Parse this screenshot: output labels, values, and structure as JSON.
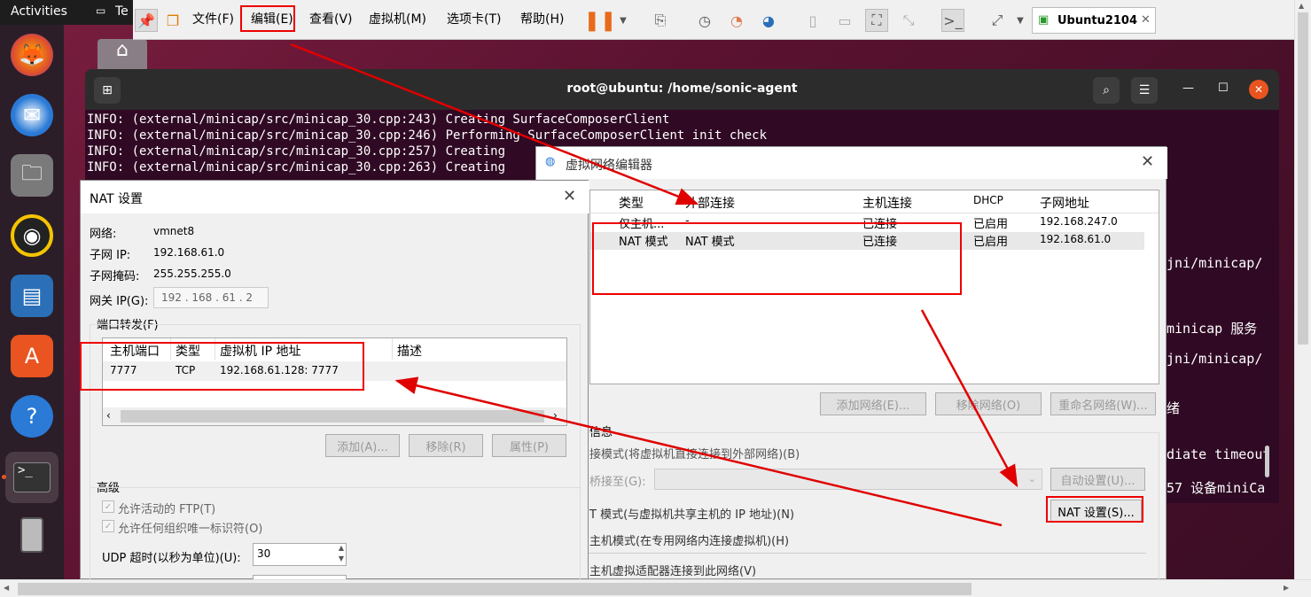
{
  "topbar": {
    "activities": "Activities",
    "app_short": "Te"
  },
  "vmware": {
    "menus": [
      "文件(F)",
      "编辑(E)",
      "查看(V)",
      "虚拟机(M)",
      "选项卡(T)",
      "帮助(H)"
    ],
    "tab_label": "Ubuntu2104"
  },
  "terminal": {
    "title": "root@ubuntu: /home/sonic-agent",
    "lines": [
      "INFO: (external/minicap/src/minicap_30.cpp:243) Creating SurfaceComposerClient",
      "INFO: (external/minicap/src/minicap_30.cpp:246) Performing SurfaceComposerClient init check",
      "INFO: (external/minicap/src/minicap_30.cpp:257) Creating",
      "INFO: (external/minicap/src/minicap_30.cpp:263) Creating"
    ],
    "right_fragments": [
      "jni/minicap/",
      "minicap 服务",
      "jni/minicap/",
      "绪",
      "diate timeout",
      "57 设备miniCa"
    ]
  },
  "vne": {
    "title": "虚拟网络编辑器",
    "columns": [
      "类型",
      "外部连接",
      "主机连接",
      "DHCP",
      "子网地址"
    ],
    "rows": [
      {
        "type": "仅主机...",
        "external": "-",
        "host": "已连接",
        "dhcp": "已启用",
        "subnet": "192.168.247.0"
      },
      {
        "type": "NAT 模式",
        "external": "NAT 模式",
        "host": "已连接",
        "dhcp": "已启用",
        "subnet": "192.168.61.0"
      }
    ],
    "add_network": "添加网络(E)...",
    "remove_network": "移除网络(O)",
    "rename_network": "重命名网络(W)...",
    "info_label": "信息",
    "bridge_mode": "接模式(将虚拟机直接连接到外部网络)(B)",
    "bridge_to": "桥接至(G):",
    "auto_settings": "自动设置(U)...",
    "nat_mode": "T 模式(与虚拟机共享主机的 IP 地址)(N)",
    "nat_settings": "NAT 设置(S)...",
    "host_only_mode": "主机模式(在专用网络内连接虚拟机)(H)",
    "connect_adapter": "主机虚拟适配器连接到此网络(V)"
  },
  "nat": {
    "title": "NAT 设置",
    "network_label": "网络:",
    "network_value": "vmnet8",
    "subnet_ip_label": "子网 IP:",
    "subnet_ip_value": "192.168.61.0",
    "subnet_mask_label": "子网掩码:",
    "subnet_mask_value": "255.255.255.0",
    "gateway_label": "网关 IP(G):",
    "gateway_value": "192 . 168 . 61 . 2",
    "port_forward_label": "端口转发(F)",
    "pf_columns": [
      "主机端口",
      "类型",
      "虚拟机 IP 地址",
      "描述"
    ],
    "pf_rows": [
      {
        "port": "7777",
        "type": "TCP",
        "vm_ip": "192.168.61.128: 7777",
        "desc": ""
      }
    ],
    "add": "添加(A)...",
    "remove": "移除(R)",
    "properties": "属性(P)",
    "advanced_label": "高级",
    "allow_ftp": "允许活动的 FTP(T)",
    "allow_oui": "允许任何组织唯一标识符(O)",
    "udp_timeout_label": "UDP 超时(以秒为单位)(U):",
    "udp_timeout_value": "30"
  },
  "colors": {
    "annotation": "#e00000",
    "terminal_bg": "#300a24"
  }
}
